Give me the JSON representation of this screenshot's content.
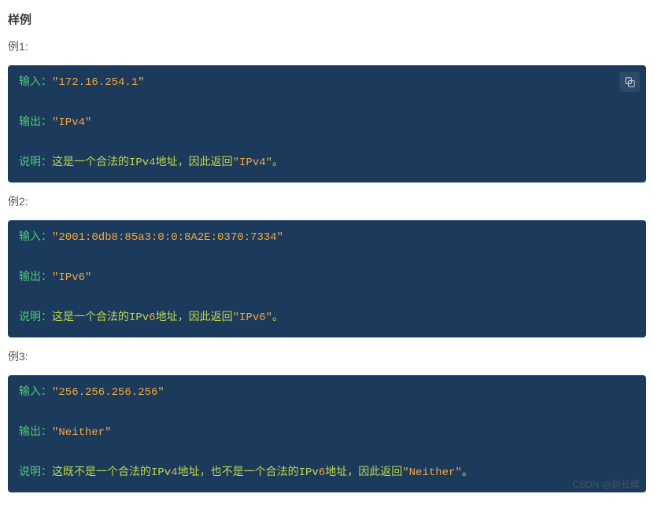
{
  "heading": "样例",
  "labels": {
    "example1": "例1:",
    "example2": "例2:",
    "example3": "例3:",
    "input": "输入：",
    "output": "输出：",
    "note": "说明："
  },
  "ex1": {
    "input_val": "\"172.16.254.1\"",
    "output_val": "\"IPv4\"",
    "note_pre": "这是一个合法的IPv",
    "note_num": "4",
    "note_mid": "地址，因此返回",
    "note_result": "\"IPv4\"",
    "note_suffix": "。"
  },
  "ex2": {
    "input_val": "\"2001:0db8:85a3:0:0:8A2E:0370:7334\"",
    "output_val": "\"IPv6\"",
    "note_pre": "这是一个合法的IPv",
    "note_num": "6",
    "note_mid": "地址，因此返回",
    "note_result": "\"IPv6\"",
    "note_suffix": "。"
  },
  "ex3": {
    "input_val": "\"256.256.256.256\"",
    "output_val": "\"Neither\"",
    "note_pre": "这既不是一个合法的IPv",
    "note_numA": "4",
    "note_midA": "地址，也不是一个合法的IPv",
    "note_numB": "6",
    "note_midB": "地址，因此返回",
    "note_result": "\"Neither\"",
    "note_suffix": "。"
  },
  "watermark": "CSDN @赵长辉"
}
